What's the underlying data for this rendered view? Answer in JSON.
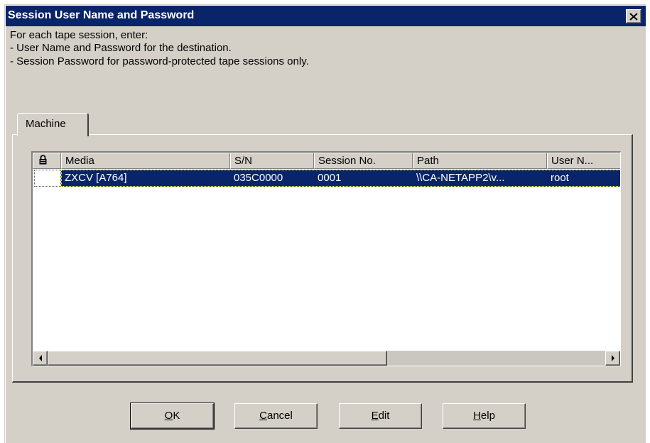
{
  "window": {
    "title": "Session User Name and Password"
  },
  "instructions": [
    "For each tape session, enter:",
    "- User Name and Password for the destination.",
    "- Session Password for password-protected tape sessions only."
  ],
  "tab": {
    "label": "Machine"
  },
  "table": {
    "columns": [
      "",
      "Media",
      "S/N",
      "Session No.",
      "Path",
      "User N..."
    ],
    "rows": [
      {
        "media": "ZXCV [A764]",
        "sn": "035C0000",
        "session_no": "0001",
        "path": "\\\\CA-NETAPP2\\v...",
        "user": "root",
        "selected": true
      }
    ]
  },
  "buttons": {
    "ok": {
      "mnemonic": "O",
      "rest": "K"
    },
    "cancel": {
      "mnemonic": "C",
      "rest": "ancel"
    },
    "edit": {
      "mnemonic": "E",
      "rest": "dit"
    },
    "help": {
      "mnemonic": "H",
      "rest": "elp"
    }
  },
  "icons": {
    "lock_column": "lock-icon",
    "close": "close-icon",
    "scroll_left": "arrow-left-icon",
    "scroll_right": "arrow-right-icon"
  }
}
